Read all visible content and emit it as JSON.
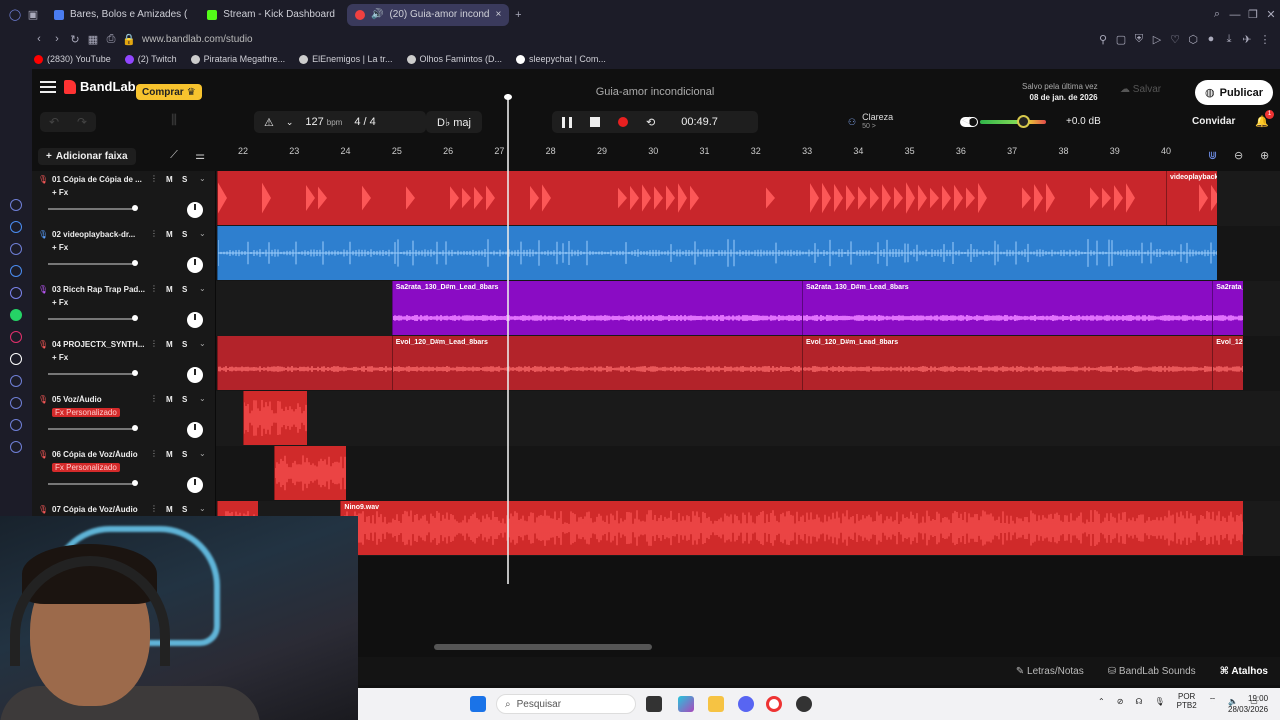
{
  "browser": {
    "tabs": [
      {
        "label": "Bares, Bolos e Amizades (",
        "color": "#4a7cf0"
      },
      {
        "label": "Stream - Kick Dashboard",
        "color": "#53fc18"
      },
      {
        "label": "(20) Guia-amor incond",
        "color": "#f04040"
      }
    ],
    "url": "www.bandlab.com/studio",
    "bookmarks": [
      {
        "label": "(2830) YouTube",
        "color": "#ff0000"
      },
      {
        "label": "(2) Twitch",
        "color": "#9146ff"
      },
      {
        "label": "Pirataria Megathre...",
        "color": "#cccccc"
      },
      {
        "label": "ElEnemigos | La tr...",
        "color": "#cccccc"
      },
      {
        "label": "Olhos Famintos (D...",
        "color": "#cccccc"
      },
      {
        "label": "sleepychat | Com...",
        "color": "#ffffff"
      }
    ]
  },
  "app": {
    "logo": "BandLab",
    "buy_label": "Comprar",
    "project_title": "Guia-amor incondicional",
    "saved_label": "Salvo pela última vez",
    "saved_date": "08 de jan. de 2026",
    "save_label": "Salvar",
    "publish_label": "Publicar"
  },
  "transport": {
    "bpm": "127",
    "bpm_unit": "bpm",
    "time_sig": "4 / 4",
    "key": "D♭ maj",
    "time": "00:49.7",
    "clarity_label": "Clareza",
    "clarity_value": "50 >",
    "volume_db": "+0.0 dB",
    "volume_level": 0.65,
    "collab_label": "Convidar",
    "notif_count": "1"
  },
  "timeline": {
    "add_track_label": "Adicionar faixa",
    "bars": [
      "22",
      "23",
      "24",
      "25",
      "26",
      "27",
      "28",
      "29",
      "30",
      "31",
      "32",
      "33",
      "34",
      "35",
      "36",
      "37",
      "38",
      "39",
      "40"
    ],
    "playhead_bar": 27.15
  },
  "tracks": [
    {
      "number": "01",
      "name": "Cópia de Cópia de ...",
      "fx": "+ Fx",
      "fx_custom": false,
      "color": "#c8262b",
      "mic_color": "#ff5a5a",
      "clips": [
        {
          "start": 21.5,
          "end": 41,
          "label": "",
          "wave": "pulse"
        },
        {
          "start": 40,
          "end": 41,
          "label": "videoplayback-bass-",
          "wave": "pulse"
        }
      ]
    },
    {
      "number": "02",
      "name": "videoplayback-dr...",
      "fx": "+ Fx",
      "fx_custom": false,
      "color": "#2e7fcf",
      "mic_color": "#5aa0ff",
      "clips": [
        {
          "start": 21.5,
          "end": 41,
          "label": "",
          "wave": "ticks"
        }
      ]
    },
    {
      "number": "03",
      "name": "Ricch Rap Trap Pad...",
      "fx": "+ Fx",
      "fx_custom": false,
      "color": "#8a0cc4",
      "mic_color": "#c05aff",
      "clips": [
        {
          "start": 24.9,
          "end": 32.9,
          "label": "Sa2rata_130_D#m_Lead_8bars",
          "wave": "flat"
        },
        {
          "start": 32.9,
          "end": 40.9,
          "label": "Sa2rata_130_D#m_Lead_8bars",
          "wave": "flat"
        },
        {
          "start": 40.9,
          "end": 41.5,
          "label": "Sa2rata_130_D#m_Le",
          "wave": "flat"
        }
      ]
    },
    {
      "number": "04",
      "name": "PROJECTX_SYNTH...",
      "fx": "+ Fx",
      "fx_custom": false,
      "color": "#b3232a",
      "mic_color": "#ff5a5a",
      "clips": [
        {
          "start": 21.5,
          "end": 24.9,
          "label": "",
          "wave": "thin"
        },
        {
          "start": 24.9,
          "end": 32.9,
          "label": "Evol_120_D#m_Lead_8bars",
          "wave": "thin"
        },
        {
          "start": 32.9,
          "end": 40.9,
          "label": "Evol_120_D#m_Lead_8bars",
          "wave": "thin"
        },
        {
          "start": 40.9,
          "end": 41.5,
          "label": "Evol_120_D#m_Lead_",
          "wave": "thin"
        }
      ]
    },
    {
      "number": "05",
      "name": "Voz/Áudio",
      "fx": "Fx Personalizado",
      "fx_custom": true,
      "color": "#d02a2a",
      "mic_color": "#ff5a5a",
      "clips": [
        {
          "start": 22.0,
          "end": 23.25,
          "label": "",
          "wave": "dense"
        }
      ]
    },
    {
      "number": "06",
      "name": "Cópia de Voz/Áudio",
      "fx": "Fx Personalizado",
      "fx_custom": true,
      "color": "#d02a2a",
      "mic_color": "#ff5a5a",
      "clips": [
        {
          "start": 22.6,
          "end": 24.0,
          "label": "",
          "wave": "dense"
        }
      ]
    },
    {
      "number": "07",
      "name": "Cópia de Voz/Áudio",
      "fx": "Fx Personalizado",
      "fx_custom": true,
      "color": "#d02a2a",
      "mic_color": "#ff5a5a",
      "clips": [
        {
          "start": 21.5,
          "end": 22.3,
          "label": "",
          "wave": "dense"
        },
        {
          "start": 23.9,
          "end": 41.5,
          "label": "Nino9.wav",
          "wave": "dense"
        }
      ]
    }
  ],
  "bottom": {
    "lyrics_label": "Letras/Notas",
    "sounds_label": "BandLab Sounds",
    "shortcuts_label": "Atalhos"
  },
  "taskbar": {
    "search_placeholder": "Pesquisar",
    "lang": "POR",
    "lang_sub": "PTB2",
    "time": "19:00",
    "date": "28/03/2026"
  }
}
